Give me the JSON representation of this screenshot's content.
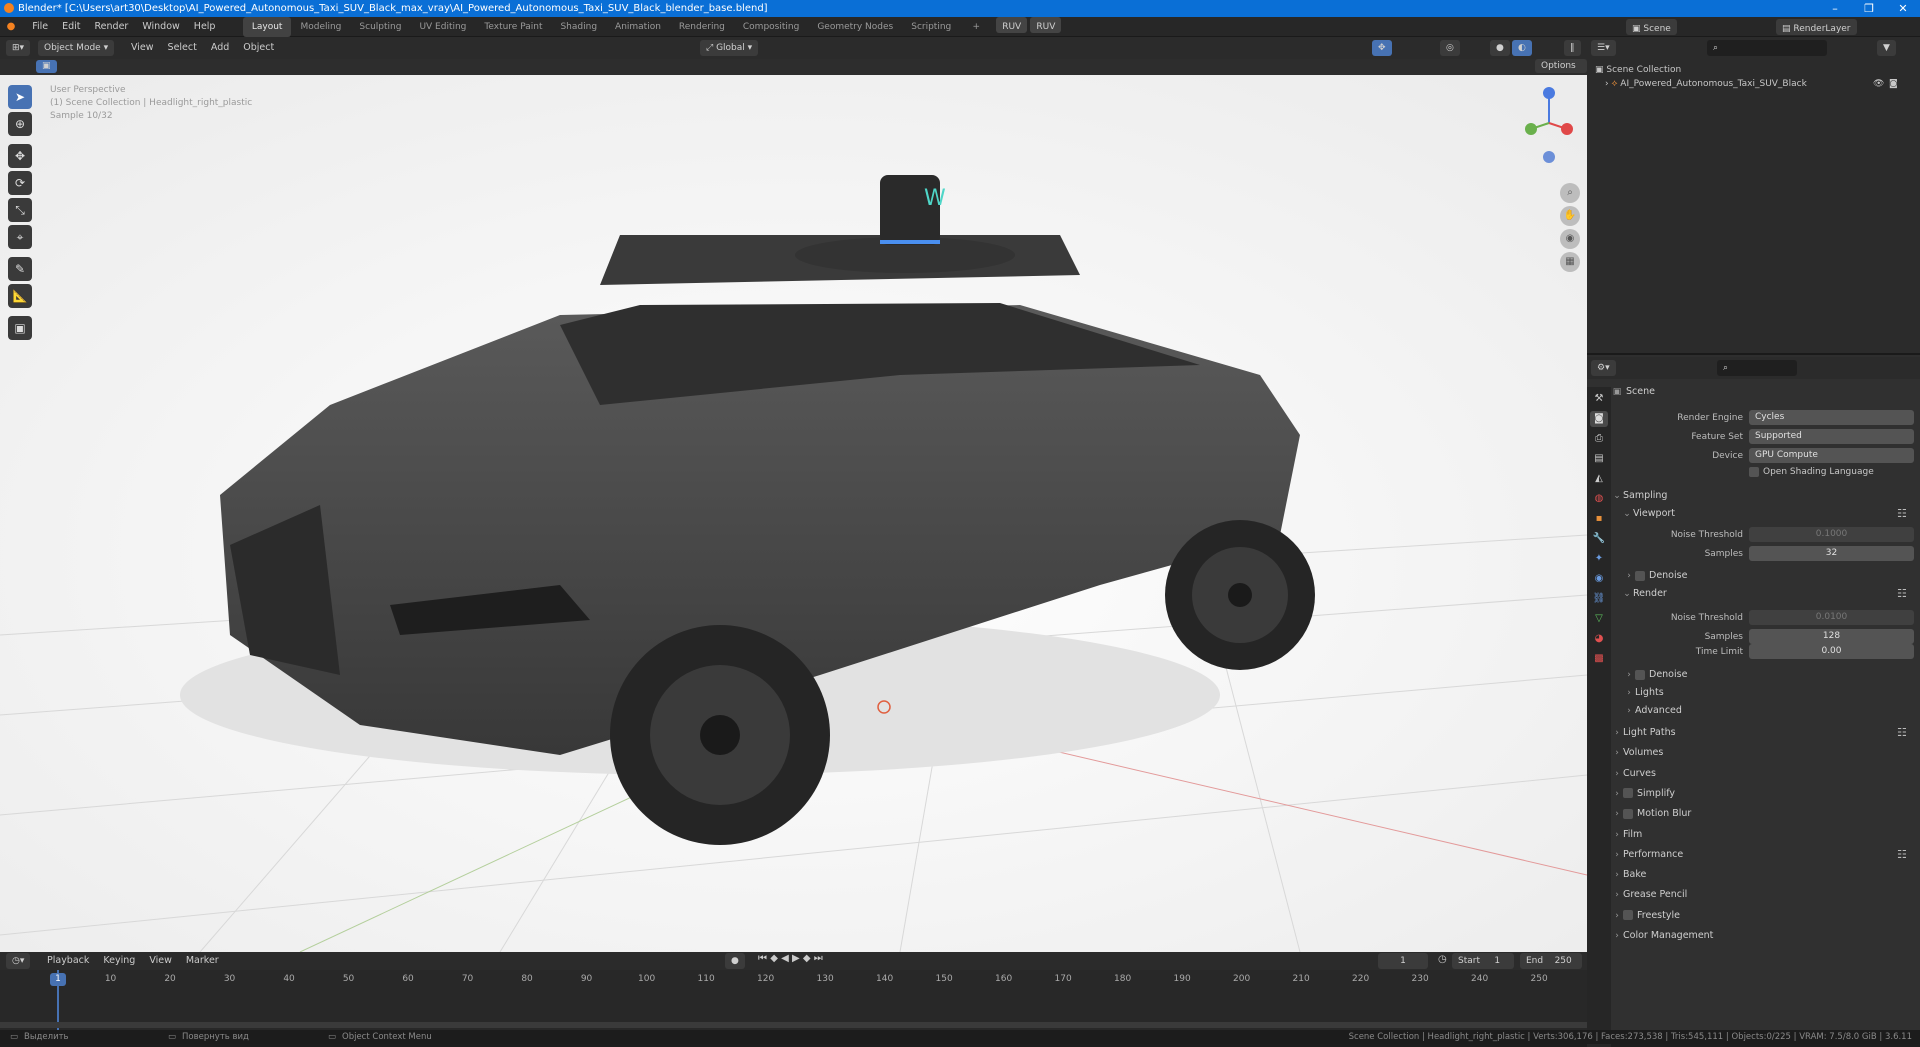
{
  "title_bar": {
    "text": "Blender* [C:\\Users\\art30\\Desktop\\AI_Powered_Autonomous_Taxi_SUV_Black_max_vray\\AI_Powered_Autonomous_Taxi_SUV_Black_blender_base.blend]",
    "min": "–",
    "max": "❐",
    "close": "✕"
  },
  "menu": {
    "items": [
      "File",
      "Edit",
      "Render",
      "Window",
      "Help"
    ],
    "workspaces": [
      "Layout",
      "Modeling",
      "Sculpting",
      "UV Editing",
      "Texture Paint",
      "Shading",
      "Animation",
      "Rendering",
      "Compositing",
      "Geometry Nodes",
      "Scripting"
    ],
    "active_workspace": "Layout",
    "ruv1": "RUV",
    "ruv2": "RUV",
    "scene": "Scene",
    "view_layer": "RenderLayer"
  },
  "viewport_header": {
    "mode": "Object Mode",
    "menus": [
      "View",
      "Select",
      "Add",
      "Object"
    ],
    "orientation": "Global",
    "options": "Options"
  },
  "viewport": {
    "perspective": "User Perspective",
    "collection": "(1) Scene Collection | Headlight_right_plastic",
    "sample": "Sample 10/32"
  },
  "outliner": {
    "root": "Scene Collection",
    "object": "AI_Powered_Autonomous_Taxi_SUV_Black"
  },
  "properties": {
    "scene_label": "Scene",
    "render_engine_label": "Render Engine",
    "render_engine": "Cycles",
    "feature_set_label": "Feature Set",
    "feature_set": "Supported",
    "device_label": "Device",
    "device": "GPU Compute",
    "osl_label": "Open Shading Language",
    "sampling": "Sampling",
    "viewport": "Viewport",
    "noise_threshold_label": "Noise Threshold",
    "viewport_noise": "0.1000",
    "samples_label": "Samples",
    "viewport_samples": "32",
    "denoise": "Denoise",
    "render": "Render",
    "render_noise": "0.0100",
    "render_samples": "128",
    "time_limit_label": "Time Limit",
    "time_limit": "0.00",
    "lights": "Lights",
    "advanced": "Advanced",
    "panels": [
      "Light Paths",
      "Volumes",
      "Curves",
      "Simplify",
      "Motion Blur",
      "Film",
      "Performance",
      "Bake",
      "Grease Pencil",
      "Freestyle",
      "Color Management"
    ]
  },
  "timeline": {
    "menus": [
      "Playback",
      "Keying",
      "View",
      "Marker"
    ],
    "current_frame": "1",
    "start_label": "Start",
    "start": "1",
    "end_label": "End",
    "end": "250",
    "ticks": [
      "1",
      "10",
      "20",
      "30",
      "40",
      "50",
      "60",
      "70",
      "80",
      "90",
      "100",
      "110",
      "120",
      "130",
      "140",
      "150",
      "160",
      "170",
      "180",
      "190",
      "200",
      "210",
      "220",
      "230",
      "240",
      "250"
    ]
  },
  "status_bar": {
    "left1": "Выделить",
    "left2": "Повернуть вид",
    "left3": "Object Context Menu",
    "right": "Scene Collection | Headlight_right_plastic | Verts:306,176 | Faces:273,538 | Tris:545,111 | Objects:0/225 | VRAM: 7.5/8.0 GiB | 3.6.11"
  },
  "colors": {
    "accent": "#4772b3",
    "title_bar": "#0a6fd6",
    "car_body": "#4a4a4a"
  }
}
